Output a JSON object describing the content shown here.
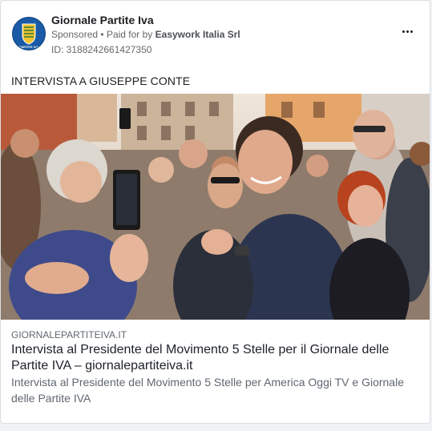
{
  "ad": {
    "page_name": "Giornale Partite Iva",
    "sponsored_label": "Sponsored",
    "separator": "•",
    "paid_for_label": "Paid for by",
    "advertiser": "Easywork Italia Srl",
    "id_text": "ID: 3188242661427350",
    "avatar_text": "PARTITE IVA"
  },
  "post": {
    "text": "INTERVISTA A GIUSEPPE CONTE",
    "image_icon": "photo-crowd-handshake"
  },
  "link": {
    "domain": "GIORNALEPARTITEIVA.IT",
    "title": "Intervista al Presidente del Movimento 5 Stelle per il Giornale delle Partite IVA – giornalepartiteiva.it",
    "description": "Intervista al Presidente del Movimento 5 Stelle per America Oggi TV e Giornale delle Partite IVA"
  },
  "colors": {
    "brand_blue": "#1a5aa6",
    "muted_text": "#65676b",
    "card_border": "#dddfe2"
  }
}
